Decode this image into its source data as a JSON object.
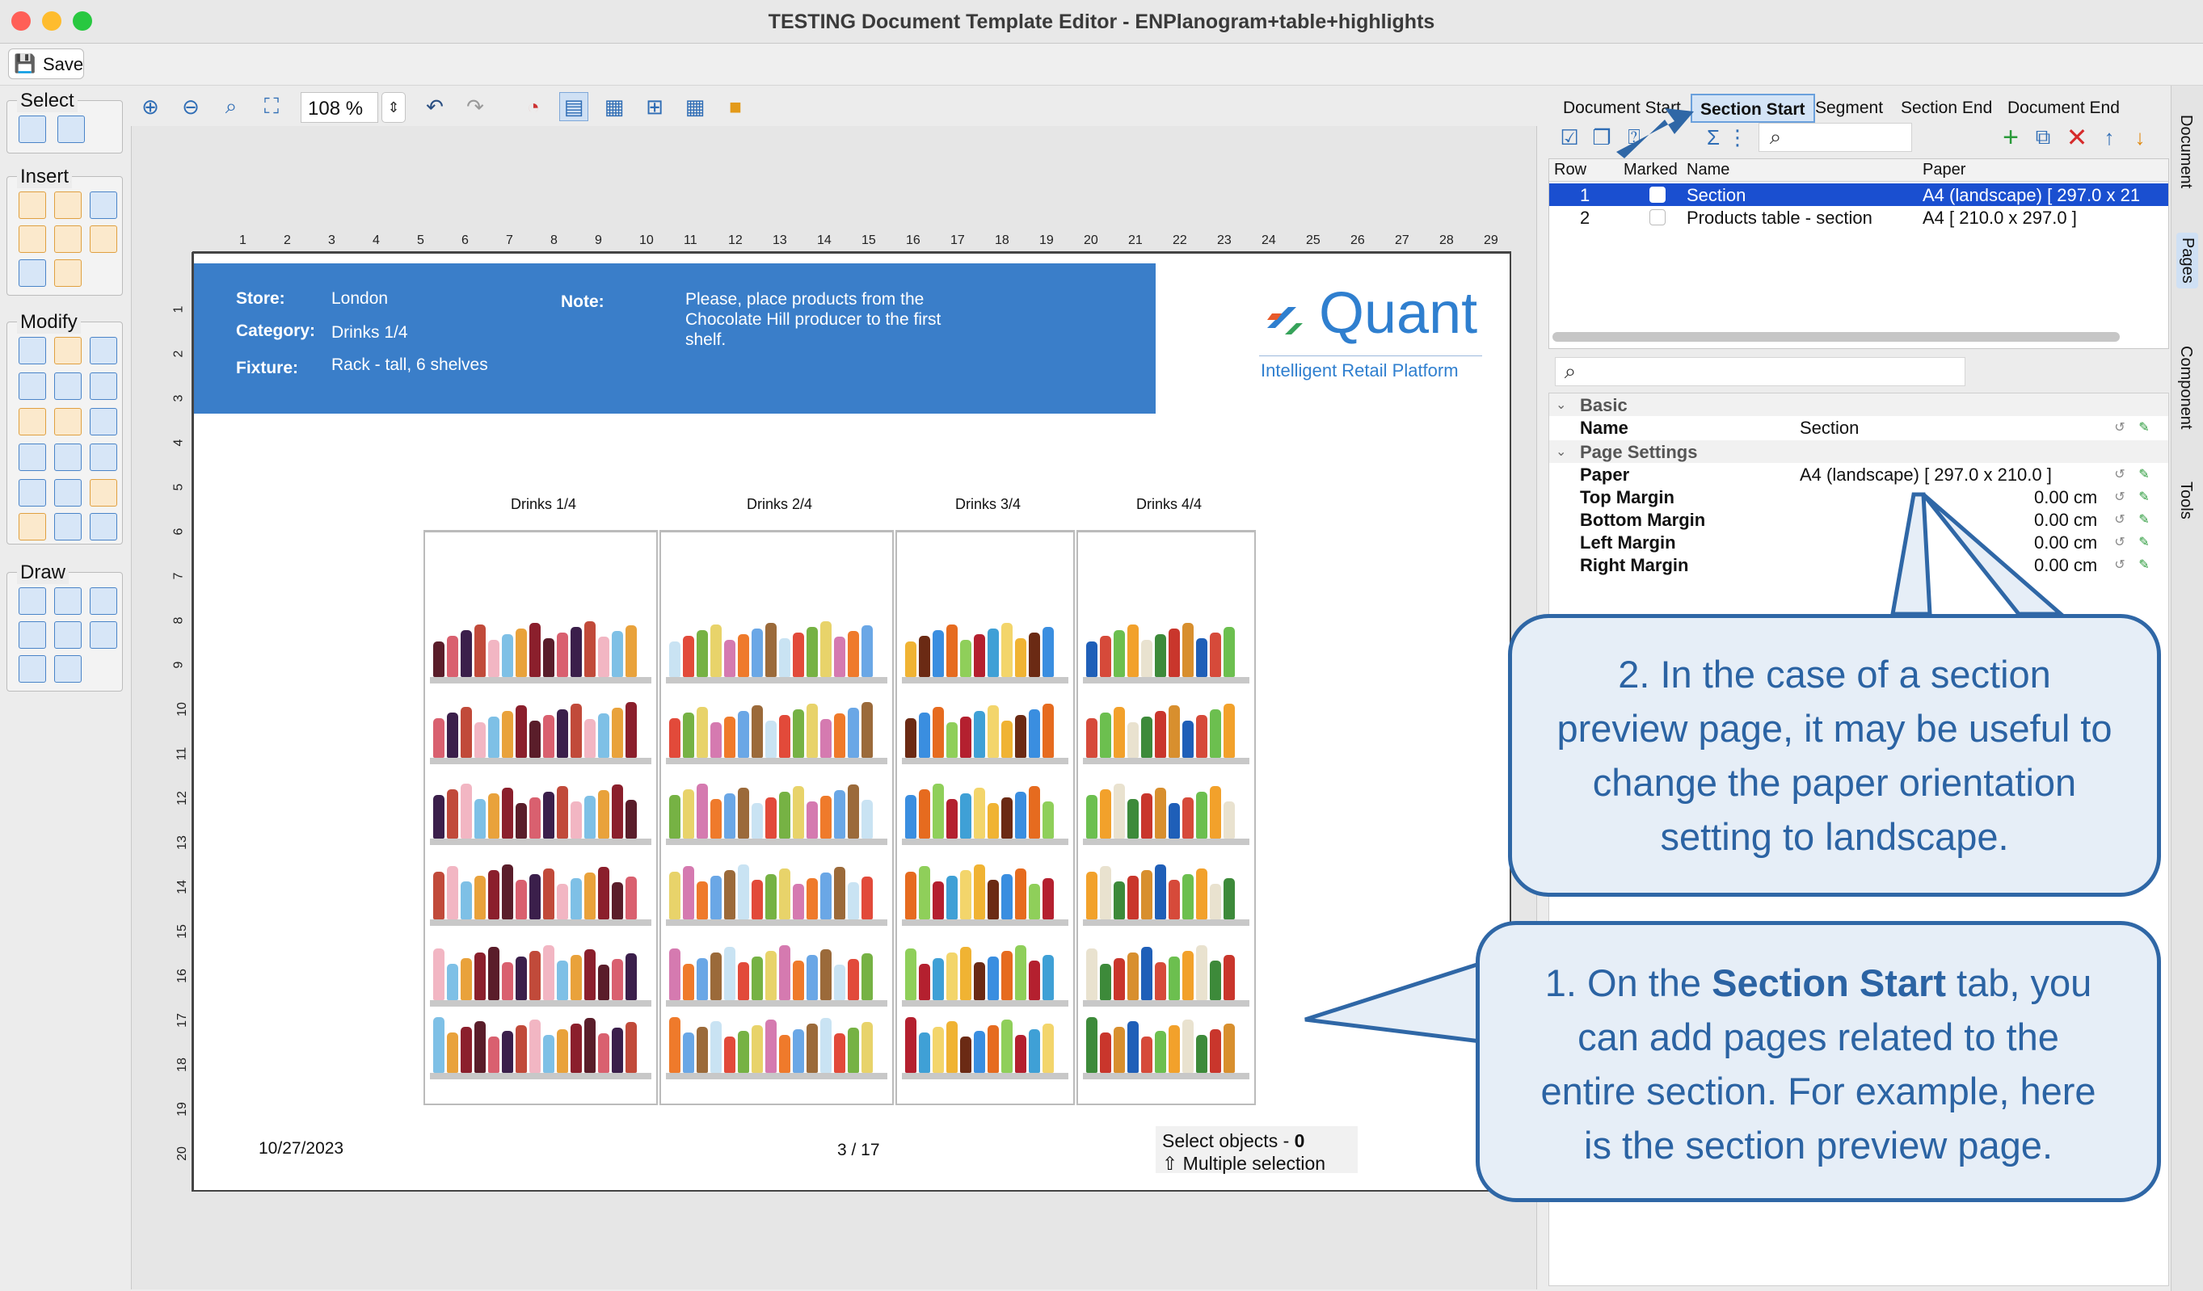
{
  "window": {
    "title": "TESTING Document Template Editor - ENPlanogram+table+highlights"
  },
  "toolbar": {
    "save_label": "Save",
    "zoom_value": "108 %"
  },
  "left_panels": {
    "select": "Select",
    "insert": "Insert",
    "modify": "Modify",
    "draw": "Draw"
  },
  "ruler": {
    "h": [
      "1",
      "2",
      "3",
      "4",
      "5",
      "6",
      "7",
      "8",
      "9",
      "10",
      "11",
      "12",
      "13",
      "14",
      "15",
      "16",
      "17",
      "18",
      "19",
      "20",
      "21",
      "22",
      "23",
      "24",
      "25",
      "26",
      "27",
      "28",
      "29"
    ],
    "v": [
      "1",
      "2",
      "3",
      "4",
      "5",
      "6",
      "7",
      "8",
      "9",
      "10",
      "11",
      "12",
      "13",
      "14",
      "15",
      "16",
      "17",
      "18",
      "19",
      "20"
    ]
  },
  "page": {
    "store_label": "Store:",
    "store_value": "London",
    "category_label": "Category:",
    "category_value": "Drinks 1/4",
    "fixture_label": "Fixture:",
    "fixture_value": "Rack - tall, 6 shelves",
    "note_label": "Note:",
    "note_value": "Please, place products from the Chocolate Hill producer to the first shelf.",
    "logo_text": "Quant",
    "logo_tagline": "Intelligent Retail Platform",
    "units": [
      "Drinks 1/4",
      "Drinks 2/4",
      "Drinks 3/4",
      "Drinks 4/4"
    ],
    "date": "10/27/2023",
    "page_number": "3 / 17",
    "select_objects_label": "Select objects - ",
    "select_objects_count": "0",
    "multiple_selection": "⇧ Multiple selection"
  },
  "tabs": [
    "Document Start",
    "Section Start",
    "Segment",
    "Section End",
    "Document End"
  ],
  "active_tab": "Section Start",
  "table": {
    "headers": [
      "Row",
      "Marked",
      "Name",
      "Paper"
    ],
    "rows": [
      {
        "row": "1",
        "name": "Section",
        "paper": "A4 (landscape) [ 297.0 x 21"
      },
      {
        "row": "2",
        "name": "Products table - section",
        "paper": "A4 [ 210.0 x 297.0 ]"
      }
    ]
  },
  "properties": {
    "basic_group": "Basic",
    "name_label": "Name",
    "name_value": "Section",
    "page_settings_group": "Page Settings",
    "paper_label": "Paper",
    "paper_value": "A4 (landscape) [ 297.0 x 210.0 ]",
    "top_margin_label": "Top Margin",
    "top_margin_value": "0.00 cm",
    "bottom_margin_label": "Bottom Margin",
    "bottom_margin_value": "0.00 cm",
    "left_margin_label": "Left Margin",
    "left_margin_value": "0.00 cm",
    "right_margin_label": "Right Margin",
    "right_margin_value": "0.00 cm"
  },
  "side_tabs": [
    "Document",
    "Pages",
    "Component",
    "Tools"
  ],
  "callouts": {
    "c2": "2. In the case of a section preview page, it may be useful to change the paper orientation setting to landscape.",
    "c1_prefix": "1. On the ",
    "c1_bold": "Section Start",
    "c1_suffix": " tab, you can add pages related to the entire section. For example, here is the section preview page."
  },
  "colors": {
    "accent": "#3a7ec9",
    "selection": "#1a4fd0",
    "callout_border": "#2f67a6"
  }
}
